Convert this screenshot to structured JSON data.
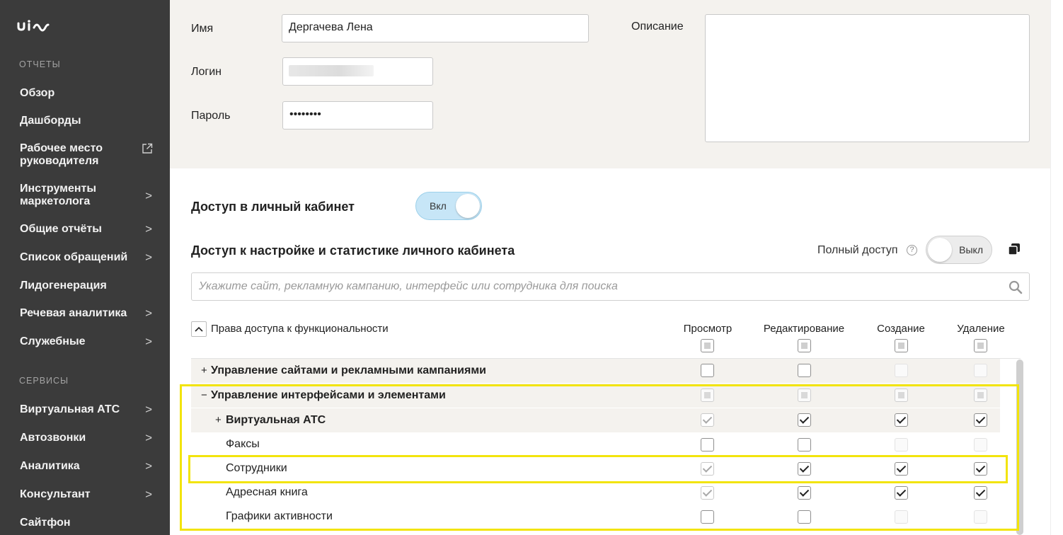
{
  "sidebar": {
    "logo": "uis",
    "sections": {
      "reports": "ОТЧЕТЫ",
      "services": "СЕРВИСЫ"
    },
    "items": [
      {
        "label": "Обзор"
      },
      {
        "label": "Дашборды"
      },
      {
        "label": "Рабочее место руководителя",
        "line1": "Рабочее место",
        "line2": "руководителя",
        "icon": "external-link-icon"
      },
      {
        "label": "Инструменты маркетолога",
        "line1": "Инструменты",
        "line2": "маркетолога",
        "arrow": ">"
      },
      {
        "label": "Общие отчёты",
        "arrow": ">"
      },
      {
        "label": "Список обращений",
        "arrow": ">"
      },
      {
        "label": "Лидогенерация"
      },
      {
        "label": "Речевая аналитика",
        "arrow": ">"
      },
      {
        "label": "Служебные",
        "arrow": ">"
      },
      {
        "label": "Виртуальная АТС",
        "arrow": ">"
      },
      {
        "label": "Автозвонки",
        "arrow": ">"
      },
      {
        "label": "Аналитика",
        "arrow": ">"
      },
      {
        "label": "Консультант",
        "arrow": ">"
      },
      {
        "label": "Сайтфон"
      }
    ]
  },
  "form": {
    "name_label": "Имя",
    "name_value": "Дергачева Лена",
    "login_label": "Логин",
    "password_label": "Пароль",
    "password_value": "••••••••",
    "description_label": "Описание"
  },
  "cabinet_access": {
    "title": "Доступ в личный кабинет",
    "toggle_label": "Вкл"
  },
  "settings_access": {
    "title": "Доступ к настройке и статистике личного кабинета",
    "full_access_label": "Полный доступ",
    "help_icon": "?",
    "toggle_label": "Выкл"
  },
  "search": {
    "placeholder": "Укажите сайт, рекламную кампанию, интерфейс или сотрудника для поиска"
  },
  "table": {
    "header_title": "Права доступа к функциональности",
    "columns": [
      "Просмотр",
      "Редактирование",
      "Создание",
      "Удаление"
    ],
    "rows": [
      {
        "label": "Управление сайтами и рекламными кампаниями",
        "toggle": "+",
        "states": [
          "empty",
          "empty",
          "disabled",
          "disabled"
        ]
      },
      {
        "label": "Управление интерфейсами и элементами",
        "toggle": "−",
        "states": [
          "indeterminate",
          "indeterminate",
          "indeterminate",
          "indeterminate"
        ]
      },
      {
        "label": "Виртуальная АТС",
        "toggle": "+",
        "states": [
          "checked-grey",
          "checked",
          "checked",
          "checked"
        ]
      },
      {
        "label": "Факсы",
        "states": [
          "empty",
          "empty",
          "disabled",
          "disabled"
        ]
      },
      {
        "label": "Сотрудники",
        "states": [
          "checked-grey",
          "checked",
          "checked",
          "checked"
        ]
      },
      {
        "label": "Адресная книга",
        "states": [
          "checked-grey",
          "checked",
          "checked",
          "checked"
        ]
      },
      {
        "label": "Графики активности",
        "states": [
          "empty",
          "empty",
          "disabled",
          "disabled"
        ]
      }
    ]
  },
  "colors": {
    "sidebar_bg": "#3b3b3b",
    "panel_bg": "#f4f2ee",
    "toggle_on": "#c7e6f7",
    "highlight": "#f2e40c"
  }
}
